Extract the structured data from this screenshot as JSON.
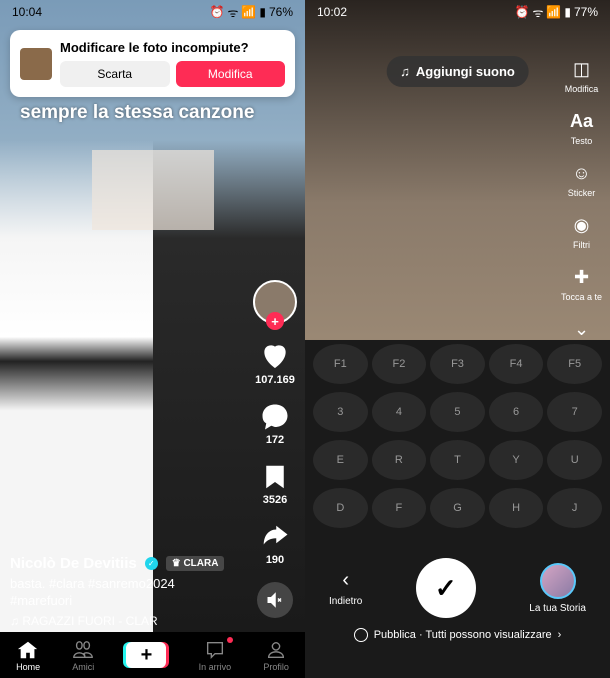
{
  "left": {
    "status": {
      "time": "10:04",
      "battery": "76%"
    },
    "popup": {
      "title": "Modificare le foto incompiute?",
      "discard": "Scarta",
      "edit": "Modifica"
    },
    "overlay_caption": "sempre la stessa canzone",
    "actions": {
      "likes": "107.169",
      "comments": "172",
      "bookmarks": "3526",
      "shares": "190"
    },
    "author": {
      "name": "Nicolò De Devitiis",
      "tag": "♛ CLARA"
    },
    "caption": "basta. #clara #sanremo2024 #marefuori",
    "music": "♫ RAGAZZI FUORI - CLAR",
    "nav": {
      "home": "Home",
      "friends": "Amici",
      "inbox": "In arrivo",
      "profile": "Profilo"
    }
  },
  "right": {
    "status": {
      "time": "10:02",
      "battery": "77%"
    },
    "add_sound": "Aggiungi suono",
    "tools": {
      "edit": "Modifica",
      "text": "Testo",
      "sticker": "Sticker",
      "filters": "Filtri",
      "yourturn": "Tocca a te"
    },
    "back": "Indietro",
    "story": "La tua Storia",
    "publish": "Pubblica · Tutti possono visualizzare"
  }
}
